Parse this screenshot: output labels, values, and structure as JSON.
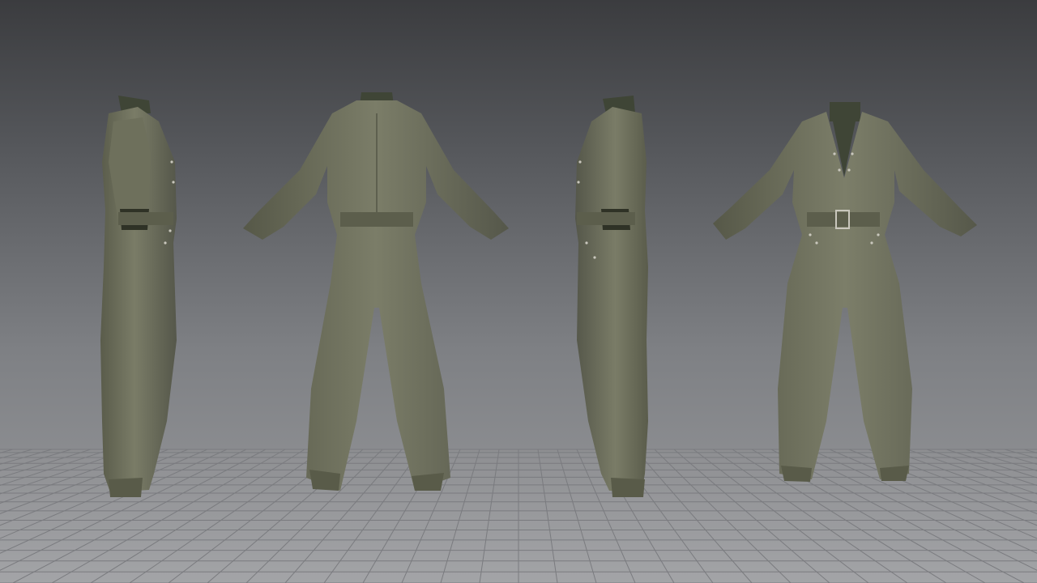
{
  "scene": {
    "background_top": "#3b3c3f",
    "background_bottom": "#9a9b9e",
    "grid_color": "#7a7b7f",
    "garment_color": "#6b6d5a",
    "garment_shadow": "#4e503f",
    "garment_highlight": "#8b8d78",
    "neck_color": "#3f4536",
    "hardware_color": "#c9c7bd"
  },
  "views": [
    {
      "name": "side-right"
    },
    {
      "name": "back"
    },
    {
      "name": "side-left"
    },
    {
      "name": "front"
    }
  ]
}
